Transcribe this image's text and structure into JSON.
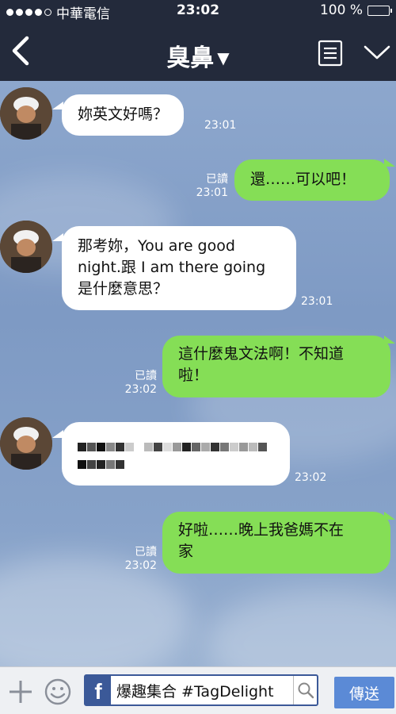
{
  "status_bar": {
    "carrier": "中華電信",
    "time": "23:02",
    "battery": "100 %",
    "battery_level": 1.0
  },
  "header": {
    "title": "臭鼻",
    "dropdown_icon": "caret-down-icon",
    "back_icon": "chevron-left-icon",
    "menu_icon": "notes-icon",
    "collapse_icon": "chevron-down-icon"
  },
  "messages": [
    {
      "from": "other",
      "text": "妳英文好嗎？",
      "time": "23:01"
    },
    {
      "from": "me",
      "text": "還……可以吧！",
      "read": "已讀",
      "time": "23:01"
    },
    {
      "from": "other",
      "text": "那考妳，You are good night.跟 I am there going 是什麼意思？",
      "line1": "那考妳，You are good",
      "line2": "night.跟 I am there going",
      "line3": "是什麼意思？",
      "time": "23:01"
    },
    {
      "from": "me",
      "text": "這什麼鬼文法啊！不知道啦！",
      "line1": "這什麼鬼文法啊！不知道",
      "line2": "啦！",
      "read": "已讀",
      "time": "23:02"
    },
    {
      "from": "other",
      "text": "",
      "pixelated": true,
      "time": "23:02"
    },
    {
      "from": "me",
      "text": "好啦……晚上我爸媽不在家",
      "line1": "好啦……晚上我爸媽不在",
      "line2": "家",
      "read": "已讀",
      "time": "23:02"
    }
  ],
  "input_bar": {
    "plus_icon": "plus-icon",
    "emoji_icon": "smiley-icon",
    "field_value": "爆趣集合 #TagDelight",
    "fb_logo": "f",
    "search_icon": "search-icon",
    "send_label": "傳送"
  },
  "colors": {
    "header_bg": "#232a3b",
    "outgoing_bubble": "#85de56",
    "incoming_bubble": "#ffffff",
    "chat_bg": "#7f9cc6",
    "send_button": "#5b8ad6"
  }
}
